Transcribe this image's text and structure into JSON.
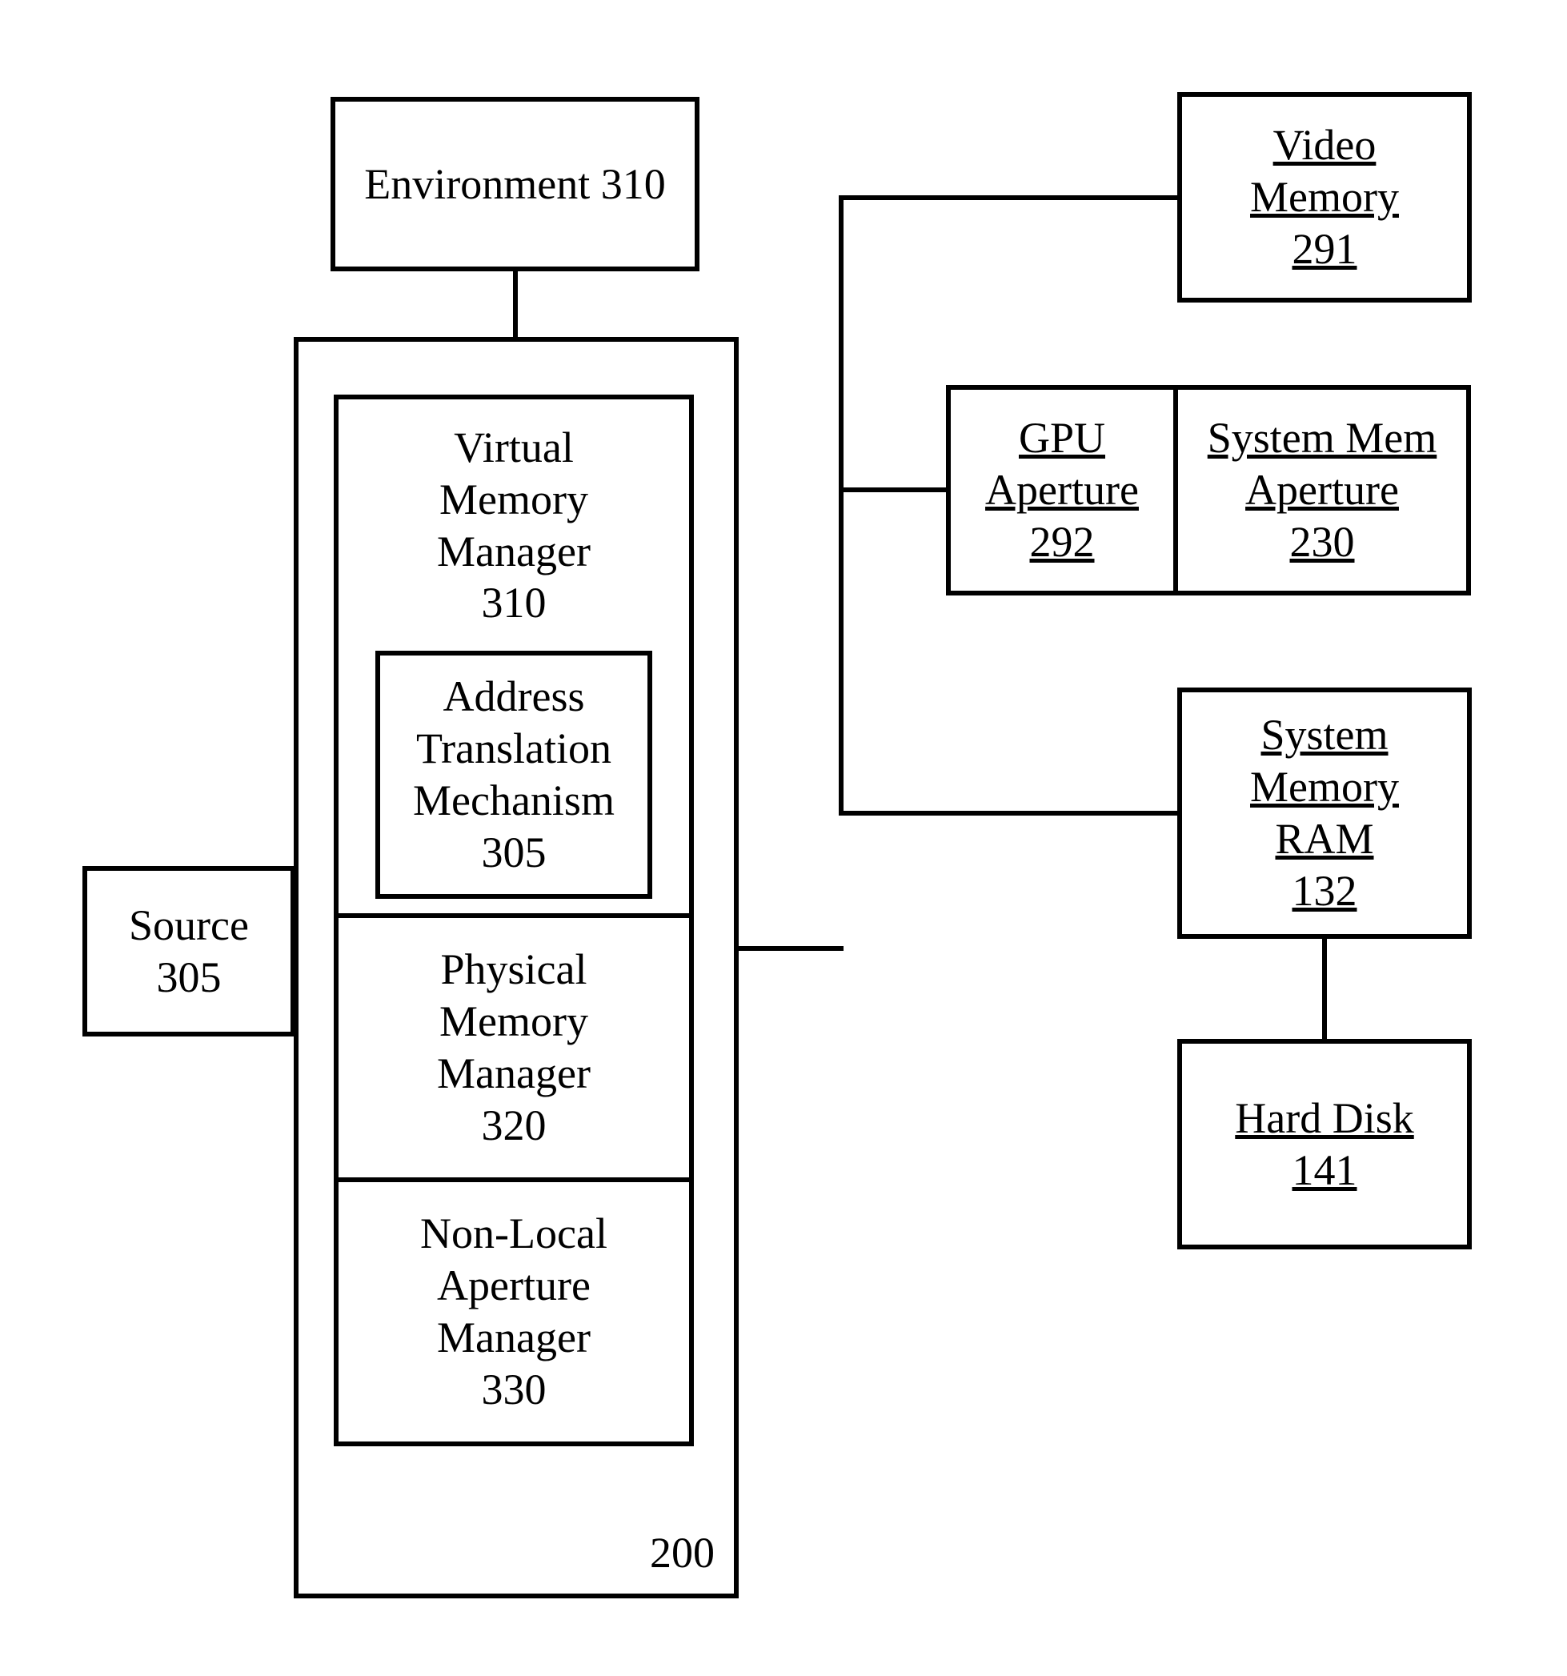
{
  "environment": {
    "label": "Environment",
    "num": "310"
  },
  "source": {
    "label": "Source",
    "num": "305"
  },
  "container": {
    "num": "200"
  },
  "vmm": {
    "label1": "Virtual",
    "label2": "Memory",
    "label3": "Manager",
    "num": "310"
  },
  "atm": {
    "label1": "Address",
    "label2": "Translation",
    "label3": "Mechanism",
    "num": "305"
  },
  "pmm": {
    "label1": "Physical",
    "label2": "Memory",
    "label3": "Manager",
    "num": "320"
  },
  "nlam": {
    "label1": "Non-Local",
    "label2": "Aperture",
    "label3": "Manager",
    "num": "330"
  },
  "video": {
    "label1": "Video",
    "label2": "Memory",
    "num": "291"
  },
  "gpuap": {
    "label1": "GPU",
    "label2": "Aperture",
    "num": "292"
  },
  "sysmemap": {
    "label1": "System Mem",
    "label2": "Aperture",
    "num": "230"
  },
  "sysram": {
    "label1": "System",
    "label2": "Memory",
    "label3": "RAM",
    "num": "132"
  },
  "hdd": {
    "label1": "Hard Disk",
    "num": "141"
  }
}
